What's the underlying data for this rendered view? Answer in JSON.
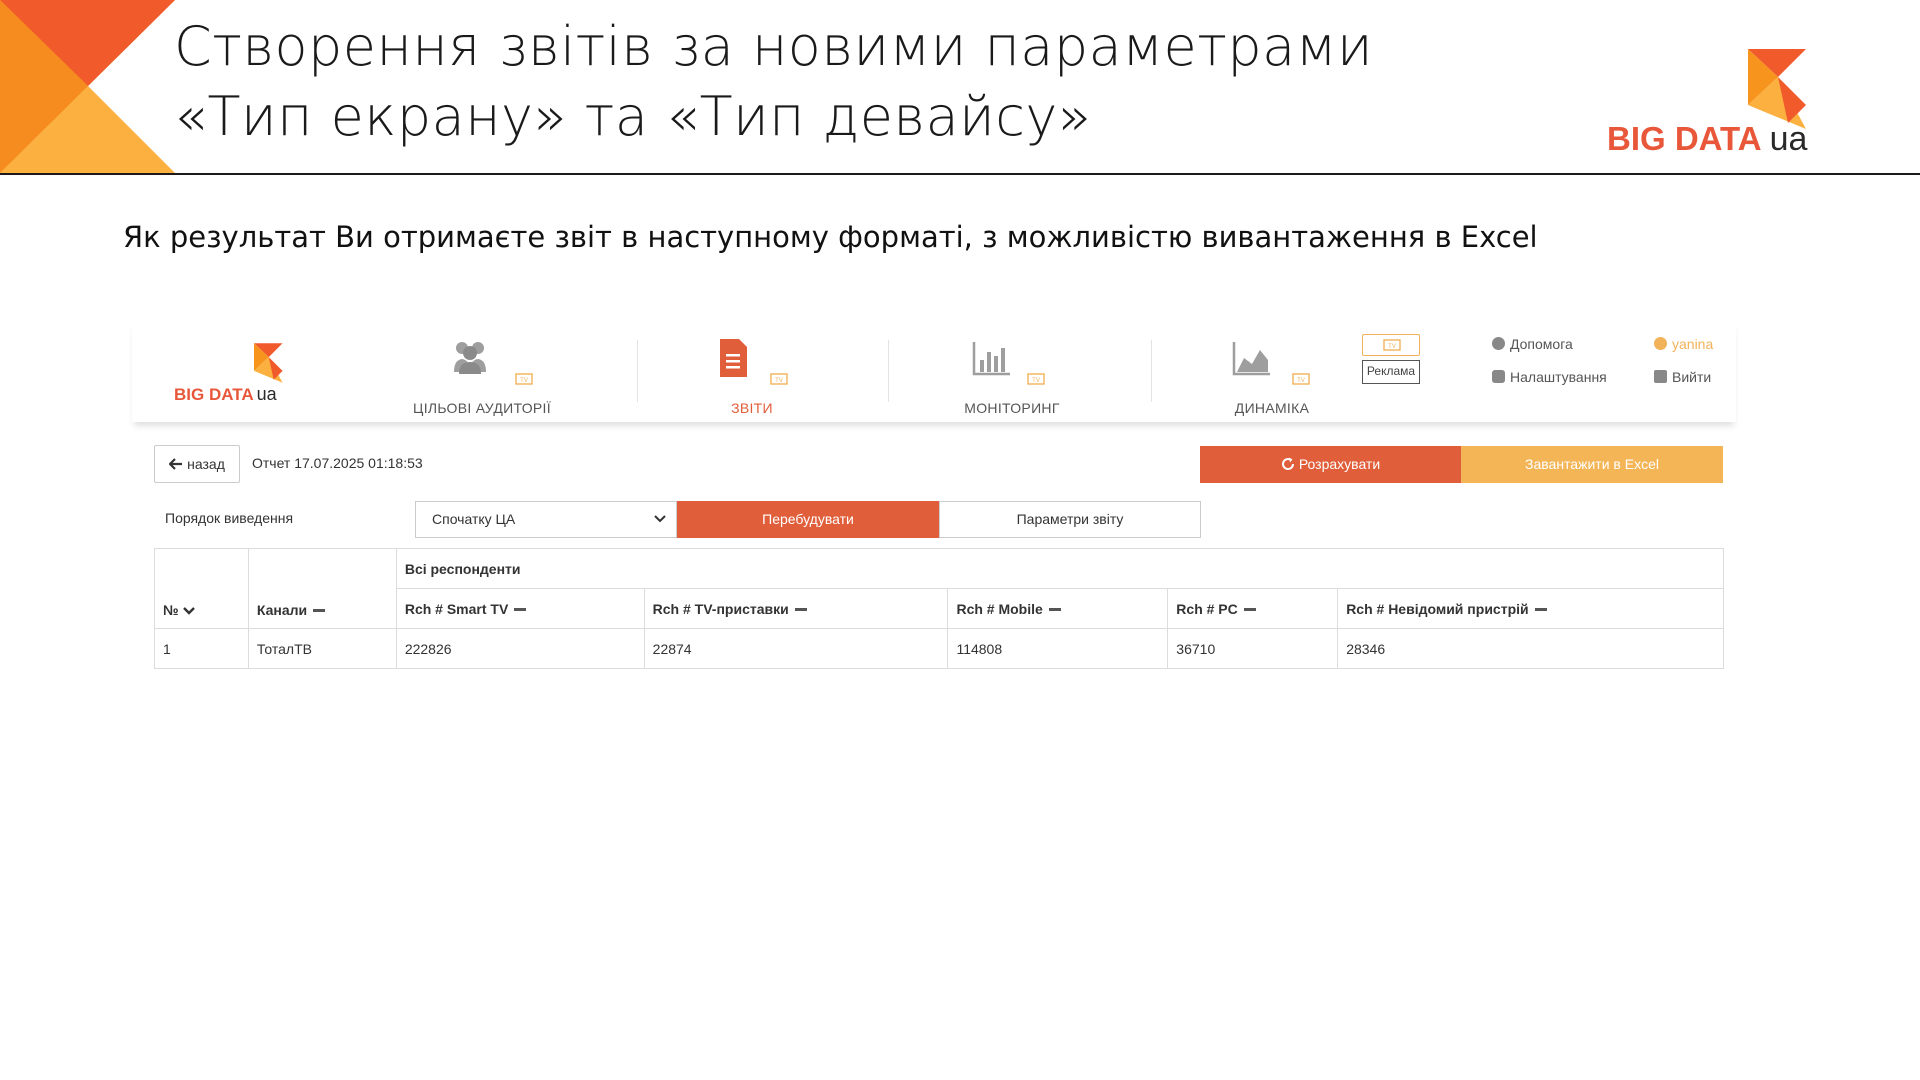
{
  "slide": {
    "title_line1": "Створення звітів за новими параметрами",
    "title_line2": "«Тип екрану» та «Тип девайсу»",
    "intro": "Як результат Ви отримаєте звіт в наступному форматі, з можливістю вивантаження в Excel",
    "brand": {
      "primary": "BIG DATA",
      "suffix": "ua"
    }
  },
  "colors": {
    "accent": "#e05e3a",
    "secondary": "#f4b557",
    "brand_orange": "#f7941d"
  },
  "app": {
    "brand": {
      "primary": "BIG DATA",
      "suffix": "ua"
    },
    "nav": [
      {
        "label": "ЦІЛЬОВІ АУДИТОРІЇ",
        "icon": "users-icon"
      },
      {
        "label": "ЗВІТИ",
        "icon": "document-icon",
        "active": true
      },
      {
        "label": "МОНІТОРИНГ",
        "icon": "bar-chart-icon"
      },
      {
        "label": "ДИНАМІКА",
        "icon": "area-chart-icon"
      }
    ],
    "reklama": "Реклама",
    "help": "Допомога",
    "settings": "Налаштування",
    "user": "yanina",
    "logout": "Вийти",
    "back": "назад",
    "report_date": "Отчет 17.07.2025 01:18:53",
    "calc": "Розрахувати",
    "excel": "Завантажити в Excel",
    "order_label": "Порядок виведення",
    "order_value": "Спочатку ЦА",
    "rebuild": "Перебудувати",
    "params": "Параметри звіту"
  },
  "table": {
    "group_header": "Всі респонденти",
    "col_num": "№",
    "col_channel": "Канали",
    "columns": [
      "Rch # Smart TV",
      "Rch # TV-приставки",
      "Rch # Mobile",
      "Rch # PC",
      "Rch # Невідомий пристрій"
    ],
    "rows": [
      {
        "num": "1",
        "channel": "ТоталТВ",
        "values": [
          "222826",
          "22874",
          "114808",
          "36710",
          "28346"
        ]
      }
    ]
  }
}
